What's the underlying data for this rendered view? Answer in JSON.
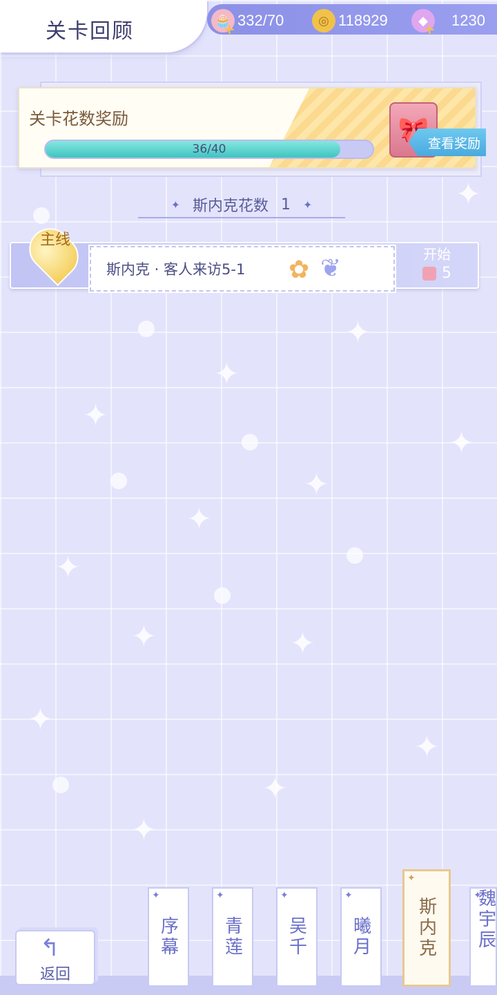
{
  "header": {
    "title": "关卡回顾",
    "resources": [
      {
        "icon": "cake-stamina-icon",
        "value": "332/70"
      },
      {
        "icon": "gold-coin-icon",
        "value": "118929"
      },
      {
        "icon": "diamond-icon",
        "value": "1230"
      }
    ]
  },
  "reward_panel": {
    "title": "关卡花数奖励",
    "progress_text": "36/40",
    "progress_value": 36,
    "progress_max": 40,
    "view_button": "查看奖励"
  },
  "flower_count": {
    "label": "斯内克花数",
    "value": "1"
  },
  "levels": [
    {
      "badge": "主线",
      "name": "斯内克 · 客人来访5-1",
      "start_label": "开始",
      "cost": "5"
    }
  ],
  "bottom": {
    "back_label": "返回",
    "tabs": [
      {
        "label": "序幕",
        "active": false
      },
      {
        "label": "青莲",
        "active": false
      },
      {
        "label": "吴千",
        "active": false
      },
      {
        "label": "曦月",
        "active": false
      },
      {
        "label": "斯内克",
        "active": true
      },
      {
        "label": "魏宇辰",
        "active": false
      }
    ]
  },
  "colors": {
    "background": "#e3e4fb",
    "accent": "#8b90e6",
    "progress": "#3fc5c0",
    "button": "#4aa9de"
  }
}
